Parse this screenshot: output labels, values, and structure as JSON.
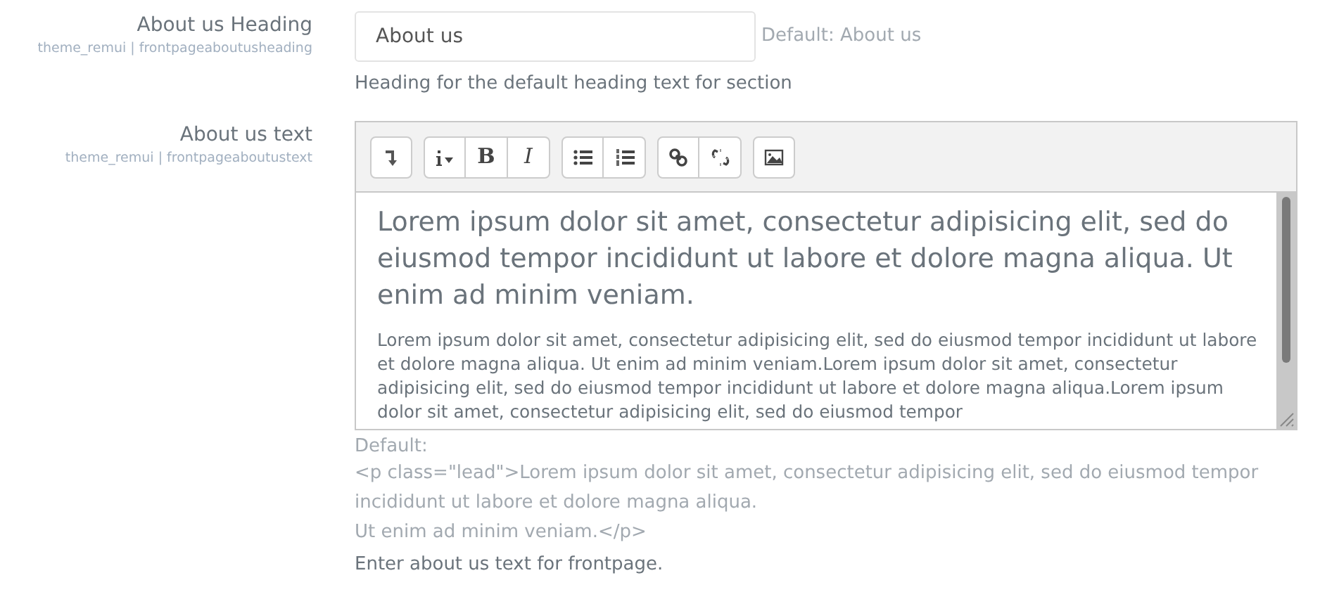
{
  "settings": [
    {
      "kind": "text",
      "label": "About us Heading",
      "key": "theme_remui | frontpageaboutusheading",
      "value": "About us",
      "default": "Default: About us",
      "description": "Heading for the default heading text for section"
    },
    {
      "kind": "editor",
      "label": "About us text",
      "key": "theme_remui | frontpageaboutustext",
      "toolbar": [
        [
          {
            "kind": "collapse"
          }
        ],
        [
          {
            "kind": "style"
          },
          {
            "kind": "char",
            "text": "B"
          },
          {
            "kind": "char",
            "text": "I",
            "italic": true
          }
        ],
        [
          {
            "kind": "ul"
          },
          {
            "kind": "ol"
          }
        ],
        [
          {
            "kind": "link"
          },
          {
            "kind": "unlink"
          }
        ],
        [
          {
            "kind": "image"
          }
        ]
      ],
      "lead": "Lorem ipsum dolor sit amet, consectetur adipisicing elit, sed do eiusmod tempor incididunt ut labore et dolore magna aliqua. Ut enim ad minim veniam.",
      "body": "Lorem ipsum dolor sit amet, consectetur adipisicing elit, sed do eiusmod tempor incididunt ut labore et dolore magna aliqua. Ut enim ad minim veniam.Lorem ipsum dolor sit amet, consectetur adipisicing elit, sed do eiusmod tempor incididunt ut labore et dolore magna aliqua.Lorem ipsum dolor sit amet, consectetur adipisicing elit, sed do eiusmod tempor",
      "default_label": "Default:",
      "default_lines": [
        "<p class=\"lead\">Lorem ipsum dolor sit amet, consectetur adipisicing elit, sed do eiusmod tempor incididunt ut labore et dolore magna aliqua.",
        "Ut enim ad minim veniam.</p>"
      ],
      "description": "Enter about us text for frontpage."
    }
  ]
}
